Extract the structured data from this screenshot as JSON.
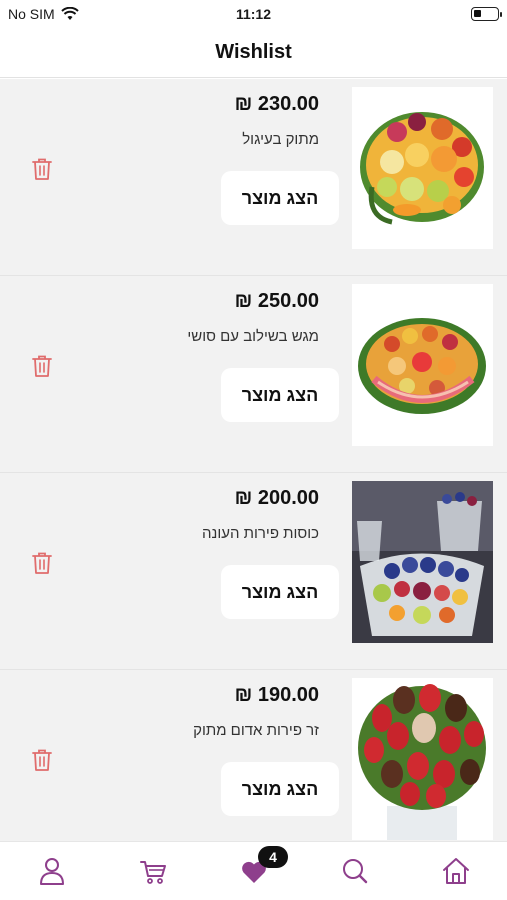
{
  "status_bar": {
    "carrier": "No SIM",
    "time": "11:12"
  },
  "header": {
    "title": "Wishlist"
  },
  "items": [
    {
      "price": "₪ 230.00",
      "name": "מתוק בעיגול",
      "button_label": "הצג מוצר"
    },
    {
      "price": "₪ 250.00",
      "name": "מגש בשילוב עם סושי",
      "button_label": "הצג מוצר"
    },
    {
      "price": "₪ 200.00",
      "name": "כוסות פירות העונה",
      "button_label": "הצג מוצר"
    },
    {
      "price": "₪ 190.00",
      "name": "זר פירות אדום מתוק",
      "button_label": "הצג מוצר"
    }
  ],
  "tabbar": {
    "wishlist_count": "4"
  },
  "colors": {
    "accent": "#8e3f8c",
    "trash": "#e06c6c"
  },
  "icons": [
    "profile-icon",
    "cart-icon",
    "heart-icon",
    "search-icon",
    "home-icon",
    "trash-icon",
    "wifi-icon",
    "battery-icon"
  ]
}
